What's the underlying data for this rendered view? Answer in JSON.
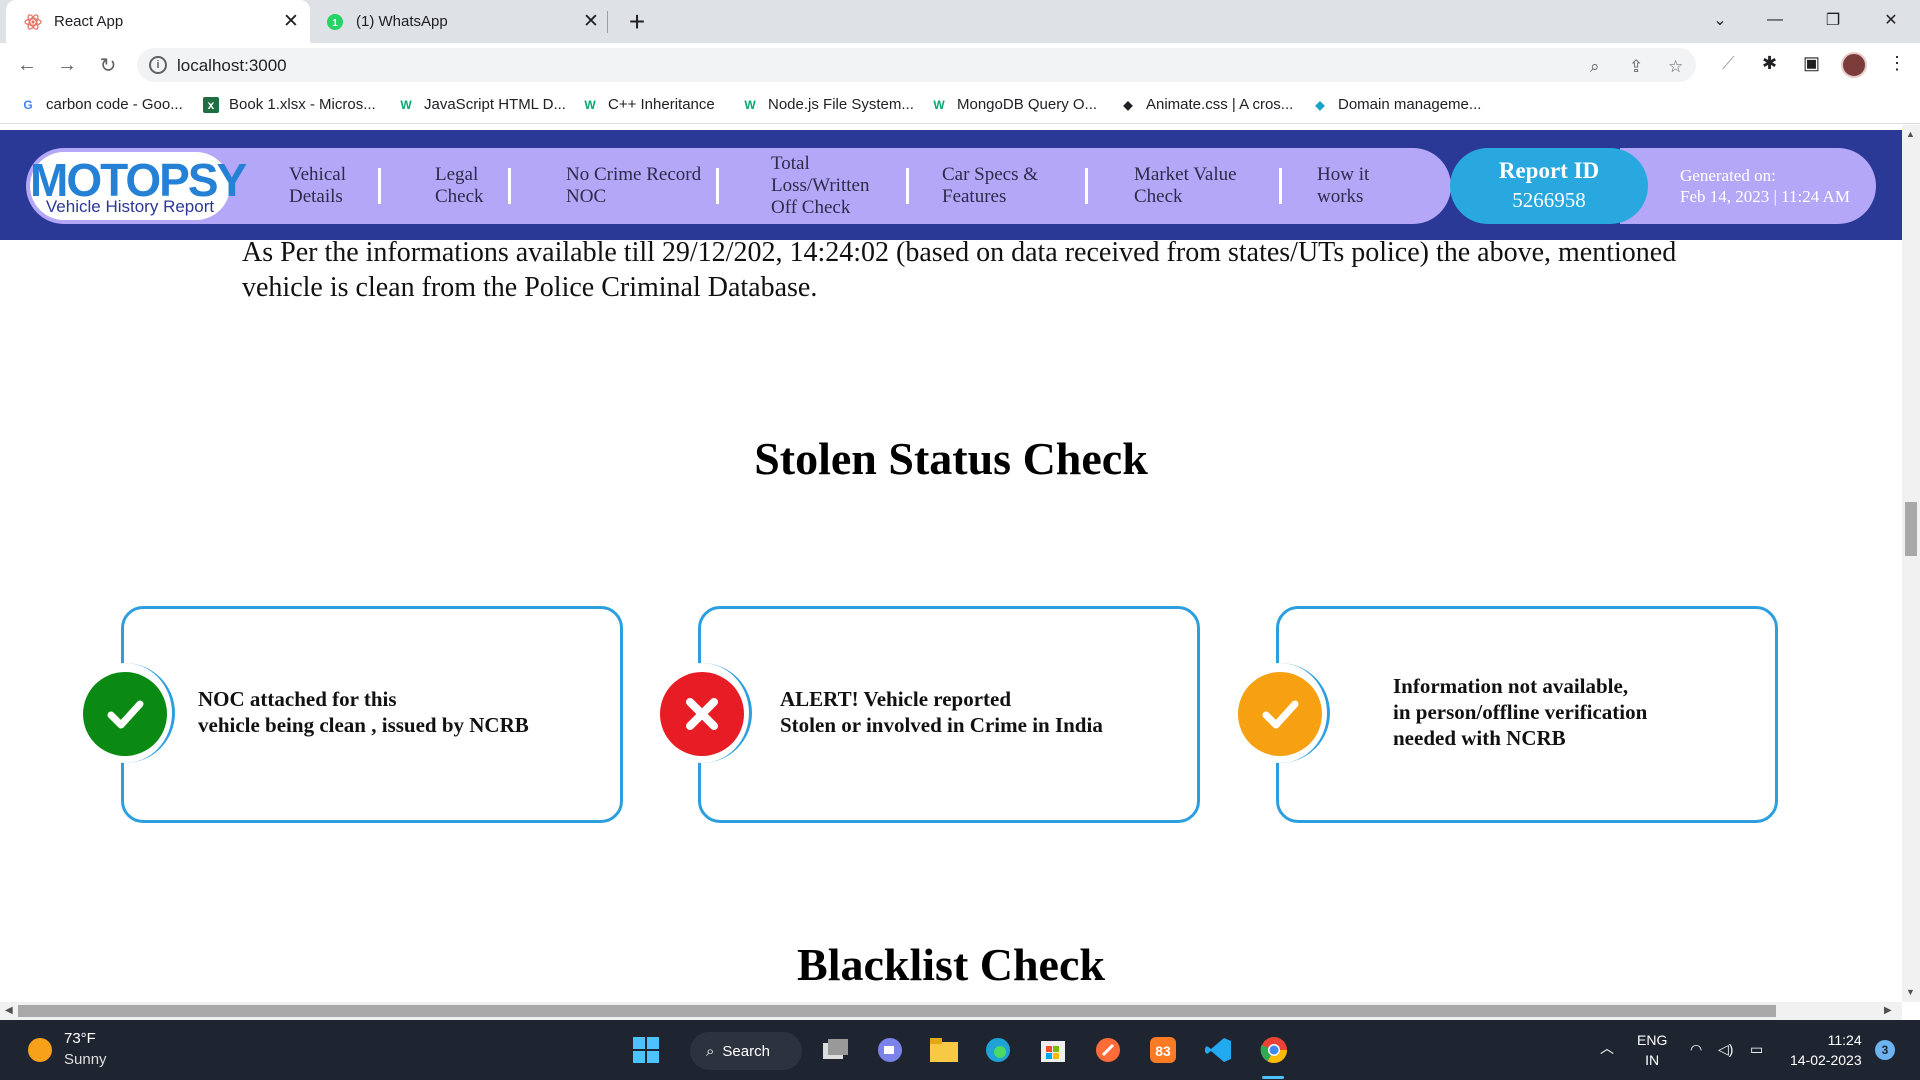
{
  "browser": {
    "tabs": [
      {
        "title": "React App",
        "active": true
      },
      {
        "title": "(1) WhatsApp",
        "active": false
      }
    ],
    "url": "localhost:3000",
    "bookmarks": [
      {
        "label": "carbon code - Goo...",
        "icon": "google-icon"
      },
      {
        "label": "Book 1.xlsx - Micros...",
        "icon": "excel-icon"
      },
      {
        "label": "JavaScript HTML D...",
        "icon": "w3schools-icon"
      },
      {
        "label": "C++ Inheritance",
        "icon": "w3schools-icon"
      },
      {
        "label": "Node.js File System...",
        "icon": "w3schools-icon"
      },
      {
        "label": "MongoDB Query O...",
        "icon": "w3schools-icon"
      },
      {
        "label": "Animate.css | A cros...",
        "icon": "animate-icon"
      },
      {
        "label": "Domain manageme...",
        "icon": "domain-icon"
      }
    ]
  },
  "site": {
    "logo": {
      "brand": "MOTOPSY",
      "subtitle": "Vehicle History Report"
    },
    "nav": [
      {
        "label": "Vehical Details"
      },
      {
        "label": "Legal Check"
      },
      {
        "label": "No Crime Record NOC"
      },
      {
        "label": "Total Loss/Written Off Check"
      },
      {
        "label": "Car Specs & Features"
      },
      {
        "label": "Market Value Check"
      },
      {
        "label": "How it works"
      }
    ],
    "report": {
      "label": "Report ID",
      "id": "5266958"
    },
    "generated": {
      "label": "Generated on:",
      "value": "Feb 14, 2023 | 11:24 AM"
    }
  },
  "content": {
    "noc_text": "As Per the informations available till 29/12/202, 14:24:02 (based on data received from states/UTs police) the above, mentioned vehicle is clean from the Police Criminal Database.",
    "stolen_title": "Stolen Status Check",
    "cards": [
      {
        "status": "clean",
        "color": "#0a8a12",
        "text": "NOC attached for this\nvehicle being clean , issued by NCRB"
      },
      {
        "status": "alert",
        "color": "#e81c24",
        "text": "ALERT! Vehicle reported\nStolen or involved in Crime in India"
      },
      {
        "status": "unavailable",
        "color": "#f7a011",
        "text": "Information not available,\nin person/offline verification\nneeded with NCRB"
      }
    ],
    "blacklist_title": "Blacklist Check"
  },
  "taskbar": {
    "weather": {
      "temp": "73°F",
      "condition": "Sunny"
    },
    "search_label": "Search",
    "lang": "ENG",
    "region": "IN",
    "time": "11:24",
    "date": "14-02-2023",
    "notifications": "3"
  }
}
